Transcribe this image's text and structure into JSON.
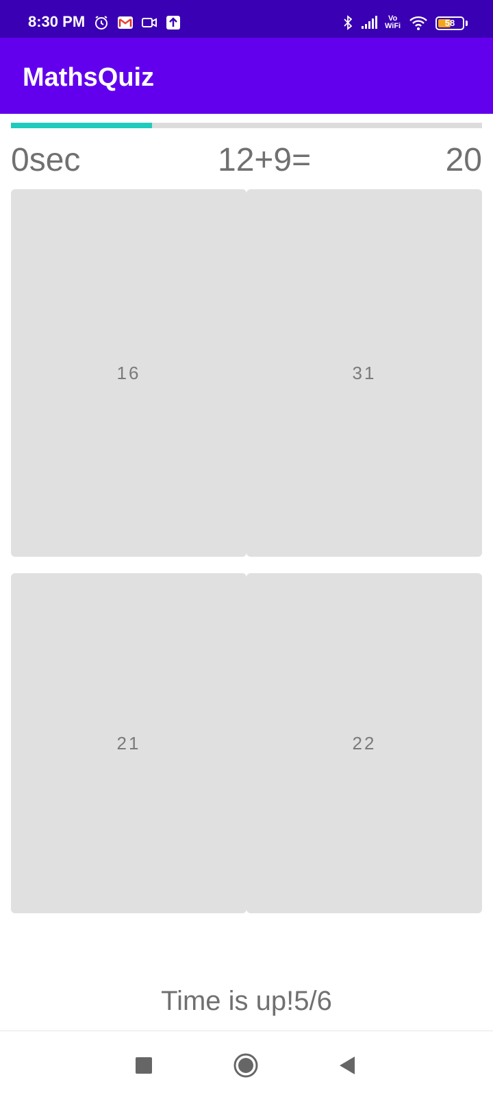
{
  "status_bar": {
    "time": "8:30 PM",
    "vowifi_top": "Vo",
    "vowifi_bottom": "WiFi",
    "battery_level": "58",
    "battery_fraction": 0.58,
    "icons": [
      "alarm-icon",
      "gmail-icon",
      "video-camera-icon",
      "upload-icon",
      "bluetooth-icon",
      "signal-icon",
      "vowifi-icon",
      "wifi-icon",
      "battery-icon"
    ]
  },
  "app_bar": {
    "title": "MathsQuiz",
    "color": "#6200ee",
    "status_color": "#3a00b3"
  },
  "quiz": {
    "progress_fraction": 0.3,
    "progress_color": "#1fcbbd",
    "timer": "0sec",
    "question": "12+9=",
    "score": "20",
    "answers": [
      "16",
      "31",
      "21",
      "22"
    ],
    "result": "Time is up!5/6"
  },
  "nav_bar": {
    "icons": [
      "recent-apps-icon",
      "home-icon",
      "back-icon"
    ]
  }
}
